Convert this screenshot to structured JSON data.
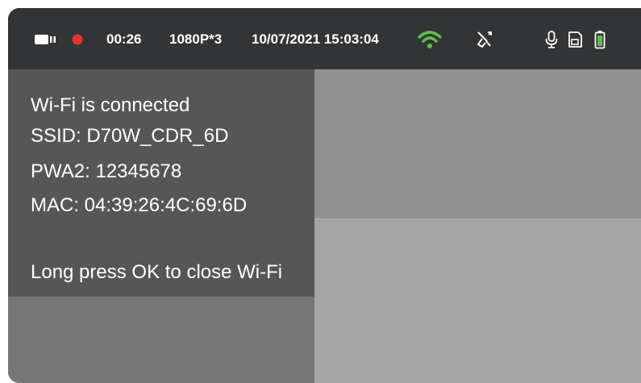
{
  "status_bar": {
    "camera_icon": "video-camera-icon",
    "record_icon": "recording-dot-icon",
    "record_color": "#e5322f",
    "elapsed_time": "00:26",
    "resolution": "1080P*3",
    "datetime": "10/07/2021 15:03:04",
    "wifi_icon": "wifi-icon",
    "wifi_color": "#5cc04a",
    "gps_icon": "gps-satellite-icon",
    "mic_icon": "microphone-icon",
    "sd_icon": "sd-card-icon",
    "battery_icon": "battery-icon",
    "battery_color": "#5cc04a"
  },
  "wifi_panel": {
    "status": "Wi-Fi is connected",
    "ssid": "SSID: D70W_CDR_6D",
    "password": "PWA2: 12345678",
    "mac": "MAC: 04:39:26:4C:69:6D",
    "hint": "Long press OK to close Wi-Fi"
  }
}
